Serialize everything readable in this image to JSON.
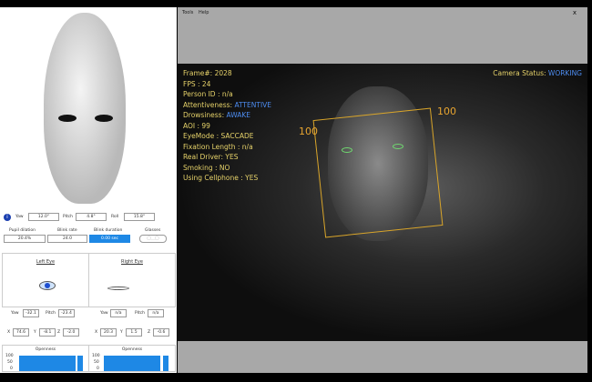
{
  "menu": {
    "tools": "Tools",
    "help": "Help",
    "close": "x"
  },
  "head_pose": {
    "yaw_label": "Yaw",
    "yaw": "12.0°",
    "pitch_label": "Pitch",
    "pitch": "4.8°",
    "roll_label": "Roll",
    "roll": "15.8°"
  },
  "metrics": {
    "pupil_label": "Pupil dilation",
    "pupil": "20.4%",
    "blink_rate_label": "Blink rate",
    "blink_rate": "24.0",
    "blink_dur_label": "Blink duration",
    "blink_dur": "0.00 sec",
    "glasses_label": "Glasses"
  },
  "left_eye": {
    "title": "Left Eye",
    "yaw_label": "Yaw",
    "yaw": "-32.1",
    "pitch_label": "Pitch",
    "pitch": "-23.4",
    "x": "74.6",
    "y": "-8.1",
    "z": "-2.0",
    "openness_label": "Openness"
  },
  "right_eye": {
    "title": "Right Eye",
    "yaw_label": "Yaw",
    "yaw": "n/a",
    "pitch_label": "Pitch",
    "pitch": "n/a",
    "x": "20.3",
    "y": "1.5",
    "z": "-0.6",
    "openness_label": "Openness"
  },
  "axis": {
    "x": "X",
    "y": "Y",
    "z": "Z",
    "t100": "100",
    "t50": "50",
    "t0": "0"
  },
  "overlay": {
    "frame": "Frame#:  2028",
    "fps": "FPS : 24",
    "person": "Person ID : n/a",
    "att_label": "Attentiveness:",
    "att": "ATTENTIVE",
    "drow_label": "Drowsiness:",
    "drow": "AWAKE",
    "aoi": "AOI : 99",
    "eyemode": "EyeMode : SACCADE",
    "fixation": "Fixation Length : n/a",
    "driver": "Real Driver: YES",
    "smoking": "Smoking : NO",
    "cellphone": "Using Cellphone : YES",
    "cam_label": "Camera Status:",
    "cam": "WORKING",
    "box_left": "100",
    "box_right": "100"
  },
  "colors": {
    "accent": "#1e88e5",
    "overlay_text": "#e6d26a",
    "status": "#4d8cf0",
    "face_box": "#d9a52a"
  }
}
